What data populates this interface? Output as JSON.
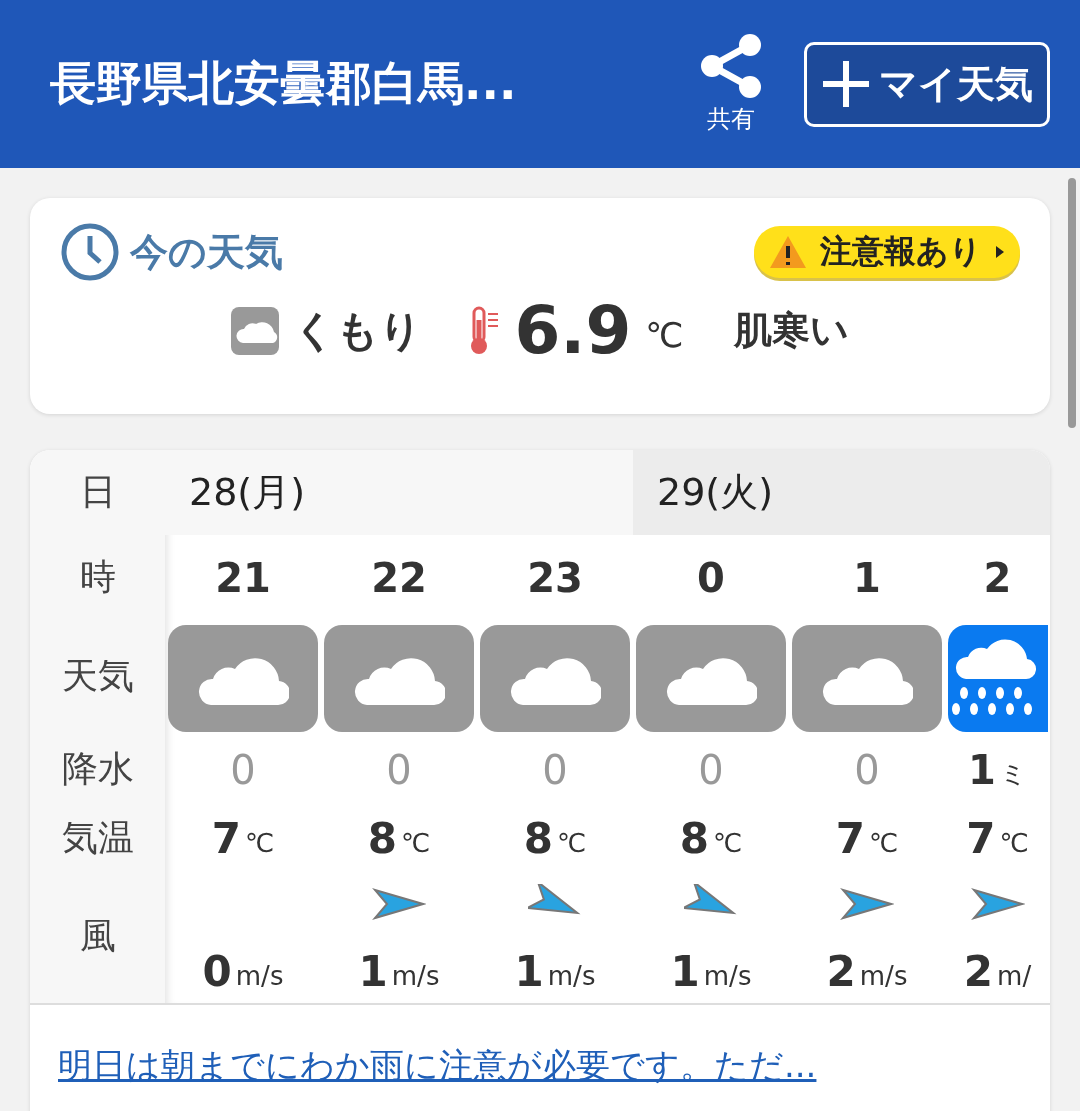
{
  "header": {
    "title": "長野県北安曇郡白馬...",
    "share_label": "共有",
    "my_weather_button": "マイ天気"
  },
  "current": {
    "heading": "今の天気",
    "alert": "注意報あり",
    "condition": "くもり",
    "temperature": "6.9",
    "temp_unit": "℃",
    "feeling": "肌寒い"
  },
  "forecast": {
    "row_labels": [
      "日",
      "時",
      "天気",
      "降水",
      "気温",
      "風"
    ],
    "days": [
      {
        "label": "28(月)",
        "hours": [
          {
            "hour": "21",
            "kind": "cloudy",
            "precip": "0",
            "temp": "7",
            "temp_unit": "℃",
            "wind": "0",
            "wind_unit": "m/s"
          },
          {
            "hour": "22",
            "kind": "cloudy",
            "precip": "0",
            "temp": "8",
            "temp_unit": "℃",
            "arrow": {
              "kind": "east"
            },
            "wind": "1",
            "wind_unit": "m/s"
          },
          {
            "hour": "23",
            "kind": "cloudy",
            "precip": "0",
            "temp": "8",
            "temp_unit": "℃",
            "arrow": {
              "kind": "eastsoutheast"
            },
            "wind": "1",
            "wind_unit": "m/s"
          }
        ]
      },
      {
        "label": "29(火)",
        "hours": [
          {
            "hour": "0",
            "kind": "cloudy",
            "precip": "0",
            "temp": "8",
            "temp_unit": "℃",
            "arrow": {
              "kind": "eastsoutheast"
            },
            "wind": "1",
            "wind_unit": "m/s"
          },
          {
            "hour": "1",
            "kind": "cloudy",
            "precip": "0",
            "temp": "7",
            "temp_unit": "℃",
            "arrow": {
              "kind": "east"
            },
            "wind": "2",
            "wind_unit": "m/s"
          },
          {
            "hour": "2",
            "kind": "rain",
            "precip": "1",
            "precip_unit": "ミ",
            "temp": "7",
            "temp_unit": "℃",
            "arrow": {
              "kind": "east"
            },
            "wind": "2",
            "wind_unit": "m/"
          }
        ]
      }
    ]
  },
  "summary_link": "明日は朝までにわか雨に注意が必要です。ただ..."
}
